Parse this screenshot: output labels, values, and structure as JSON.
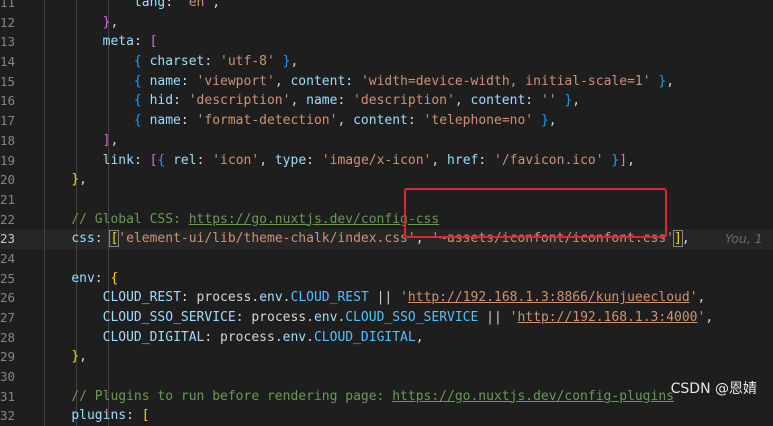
{
  "lines": [
    {
      "num": "11",
      "parts": [
        {
          "t": "            ",
          "c": "p"
        },
        {
          "t": "lang",
          "c": "k"
        },
        {
          "t": ": ",
          "c": "p"
        },
        {
          "t": "'en'",
          "c": "s"
        },
        {
          "t": ",",
          "c": "p"
        }
      ]
    },
    {
      "num": "12",
      "parts": [
        {
          "t": "        ",
          "c": "p"
        },
        {
          "t": "}",
          "c": "b2"
        },
        {
          "t": ",",
          "c": "p"
        }
      ]
    },
    {
      "num": "13",
      "parts": [
        {
          "t": "        ",
          "c": "p"
        },
        {
          "t": "meta",
          "c": "k"
        },
        {
          "t": ": ",
          "c": "p"
        },
        {
          "t": "[",
          "c": "b2"
        }
      ]
    },
    {
      "num": "14",
      "parts": [
        {
          "t": "            ",
          "c": "p"
        },
        {
          "t": "{",
          "c": "b3"
        },
        {
          "t": " ",
          "c": "p"
        },
        {
          "t": "charset",
          "c": "k"
        },
        {
          "t": ": ",
          "c": "p"
        },
        {
          "t": "'utf-8'",
          "c": "s"
        },
        {
          "t": " ",
          "c": "p"
        },
        {
          "t": "}",
          "c": "b3"
        },
        {
          "t": ",",
          "c": "p"
        }
      ]
    },
    {
      "num": "15",
      "parts": [
        {
          "t": "            ",
          "c": "p"
        },
        {
          "t": "{",
          "c": "b3"
        },
        {
          "t": " ",
          "c": "p"
        },
        {
          "t": "name",
          "c": "k"
        },
        {
          "t": ": ",
          "c": "p"
        },
        {
          "t": "'viewport'",
          "c": "s"
        },
        {
          "t": ", ",
          "c": "p"
        },
        {
          "t": "content",
          "c": "k"
        },
        {
          "t": ": ",
          "c": "p"
        },
        {
          "t": "'width=device-width, initial-scale=1'",
          "c": "s"
        },
        {
          "t": " ",
          "c": "p"
        },
        {
          "t": "}",
          "c": "b3"
        },
        {
          "t": ",",
          "c": "p"
        }
      ]
    },
    {
      "num": "16",
      "parts": [
        {
          "t": "            ",
          "c": "p"
        },
        {
          "t": "{",
          "c": "b3"
        },
        {
          "t": " ",
          "c": "p"
        },
        {
          "t": "hid",
          "c": "k"
        },
        {
          "t": ": ",
          "c": "p"
        },
        {
          "t": "'description'",
          "c": "s"
        },
        {
          "t": ", ",
          "c": "p"
        },
        {
          "t": "name",
          "c": "k"
        },
        {
          "t": ": ",
          "c": "p"
        },
        {
          "t": "'description'",
          "c": "s"
        },
        {
          "t": ", ",
          "c": "p"
        },
        {
          "t": "content",
          "c": "k"
        },
        {
          "t": ": ",
          "c": "p"
        },
        {
          "t": "''",
          "c": "s"
        },
        {
          "t": " ",
          "c": "p"
        },
        {
          "t": "}",
          "c": "b3"
        },
        {
          "t": ",",
          "c": "p"
        }
      ]
    },
    {
      "num": "17",
      "parts": [
        {
          "t": "            ",
          "c": "p"
        },
        {
          "t": "{",
          "c": "b3"
        },
        {
          "t": " ",
          "c": "p"
        },
        {
          "t": "name",
          "c": "k"
        },
        {
          "t": ": ",
          "c": "p"
        },
        {
          "t": "'format-detection'",
          "c": "s"
        },
        {
          "t": ", ",
          "c": "p"
        },
        {
          "t": "content",
          "c": "k"
        },
        {
          "t": ": ",
          "c": "p"
        },
        {
          "t": "'telephone=no'",
          "c": "s"
        },
        {
          "t": " ",
          "c": "p"
        },
        {
          "t": "}",
          "c": "b3"
        },
        {
          "t": ",",
          "c": "p"
        }
      ]
    },
    {
      "num": "18",
      "parts": [
        {
          "t": "        ",
          "c": "p"
        },
        {
          "t": "]",
          "c": "b2"
        },
        {
          "t": ",",
          "c": "p"
        }
      ]
    },
    {
      "num": "19",
      "parts": [
        {
          "t": "        ",
          "c": "p"
        },
        {
          "t": "link",
          "c": "k"
        },
        {
          "t": ": ",
          "c": "p"
        },
        {
          "t": "[",
          "c": "b2"
        },
        {
          "t": "{",
          "c": "b3"
        },
        {
          "t": " ",
          "c": "p"
        },
        {
          "t": "rel",
          "c": "k"
        },
        {
          "t": ": ",
          "c": "p"
        },
        {
          "t": "'icon'",
          "c": "s"
        },
        {
          "t": ", ",
          "c": "p"
        },
        {
          "t": "type",
          "c": "k"
        },
        {
          "t": ": ",
          "c": "p"
        },
        {
          "t": "'image/x-icon'",
          "c": "s"
        },
        {
          "t": ", ",
          "c": "p"
        },
        {
          "t": "href",
          "c": "k"
        },
        {
          "t": ": ",
          "c": "p"
        },
        {
          "t": "'/favicon.ico'",
          "c": "s"
        },
        {
          "t": " ",
          "c": "p"
        },
        {
          "t": "}",
          "c": "b3"
        },
        {
          "t": "]",
          "c": "b2"
        },
        {
          "t": ",",
          "c": "p"
        }
      ]
    },
    {
      "num": "20",
      "parts": [
        {
          "t": "    ",
          "c": "p"
        },
        {
          "t": "}",
          "c": "b1"
        },
        {
          "t": ",",
          "c": "p"
        }
      ]
    },
    {
      "num": "21",
      "parts": []
    },
    {
      "num": "22",
      "parts": [
        {
          "t": "    ",
          "c": "p"
        },
        {
          "t": "// Global CSS: ",
          "c": "c"
        },
        {
          "t": "https://go.nuxtjs.dev/config-css",
          "c": "c u"
        }
      ]
    },
    {
      "num": "23",
      "active": true,
      "parts": [
        {
          "t": "    ",
          "c": "p"
        },
        {
          "t": "css",
          "c": "k"
        },
        {
          "t": ": ",
          "c": "p"
        },
        {
          "t": "[",
          "c": "b1 bracket-box"
        },
        {
          "t": "'element-ui/lib/theme-chalk/index.css'",
          "c": "s"
        },
        {
          "t": ", ",
          "c": "p"
        },
        {
          "t": "'~assets/iconfont/iconfont.css'",
          "c": "s"
        },
        {
          "t": "]",
          "c": "b1 bracket-box"
        },
        {
          "t": ",",
          "c": "p"
        }
      ],
      "blame": "You, 1"
    },
    {
      "num": "24",
      "parts": []
    },
    {
      "num": "25",
      "parts": [
        {
          "t": "    ",
          "c": "p"
        },
        {
          "t": "env",
          "c": "k"
        },
        {
          "t": ": ",
          "c": "p"
        },
        {
          "t": "{",
          "c": "b1"
        }
      ]
    },
    {
      "num": "26",
      "parts": [
        {
          "t": "        ",
          "c": "p"
        },
        {
          "t": "CLOUD_REST",
          "c": "k"
        },
        {
          "t": ": process.",
          "c": "p"
        },
        {
          "t": "env",
          "c": "k"
        },
        {
          "t": ".",
          "c": "p"
        },
        {
          "t": "CLOUD_REST",
          "c": "v"
        },
        {
          "t": " || ",
          "c": "p"
        },
        {
          "t": "'",
          "c": "s"
        },
        {
          "t": "http://192.168.1.3:8866/kunjueecloud",
          "c": "s u"
        },
        {
          "t": "'",
          "c": "s"
        },
        {
          "t": ",",
          "c": "p"
        }
      ]
    },
    {
      "num": "27",
      "parts": [
        {
          "t": "        ",
          "c": "p"
        },
        {
          "t": "CLOUD_SSO_SERVICE",
          "c": "k"
        },
        {
          "t": ": process.",
          "c": "p"
        },
        {
          "t": "env",
          "c": "k"
        },
        {
          "t": ".",
          "c": "p"
        },
        {
          "t": "CLOUD_SSO_SERVICE",
          "c": "v"
        },
        {
          "t": " || ",
          "c": "p"
        },
        {
          "t": "'",
          "c": "s"
        },
        {
          "t": "http://192.168.1.3:4000",
          "c": "s u"
        },
        {
          "t": "'",
          "c": "s"
        },
        {
          "t": ",",
          "c": "p"
        }
      ]
    },
    {
      "num": "28",
      "parts": [
        {
          "t": "        ",
          "c": "p"
        },
        {
          "t": "CLOUD_DIGITAL",
          "c": "k"
        },
        {
          "t": ": process.",
          "c": "p"
        },
        {
          "t": "env",
          "c": "k"
        },
        {
          "t": ".",
          "c": "p"
        },
        {
          "t": "CLOUD_DIGITAL",
          "c": "v"
        },
        {
          "t": ",",
          "c": "p"
        }
      ]
    },
    {
      "num": "29",
      "parts": [
        {
          "t": "    ",
          "c": "p"
        },
        {
          "t": "}",
          "c": "b1"
        },
        {
          "t": ",",
          "c": "p"
        }
      ]
    },
    {
      "num": "30",
      "parts": []
    },
    {
      "num": "31",
      "parts": [
        {
          "t": "    ",
          "c": "p"
        },
        {
          "t": "// Plugins to run before rendering page: ",
          "c": "c"
        },
        {
          "t": "https://go.nuxtjs.dev/config-plugins",
          "c": "c u"
        }
      ]
    },
    {
      "num": "32",
      "parts": [
        {
          "t": "    ",
          "c": "p"
        },
        {
          "t": "plugins",
          "c": "k"
        },
        {
          "t": ": ",
          "c": "p"
        },
        {
          "t": "[",
          "c": "b1"
        }
      ]
    }
  ],
  "watermark": "CSDN @恩婧",
  "colors": {
    "background": "#1e1e1e",
    "highlight_box": "#e0252b"
  }
}
